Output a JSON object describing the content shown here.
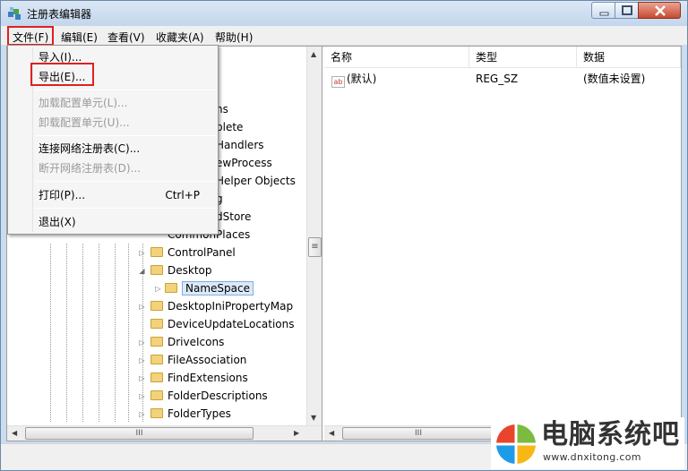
{
  "window": {
    "title": "注册表编辑器"
  },
  "menubar": {
    "items": [
      "文件(F)",
      "编辑(E)",
      "查看(V)",
      "收藏夹(A)",
      "帮助(H)"
    ]
  },
  "file_menu": {
    "items": [
      {
        "label": "导入(I)...",
        "accel": "",
        "enabled": true
      },
      {
        "label": "导出(E)...",
        "accel": "",
        "enabled": true
      },
      {
        "label": "加载配置单元(L)...",
        "accel": "",
        "enabled": false
      },
      {
        "label": "卸载配置单元(U)...",
        "accel": "",
        "enabled": false
      },
      {
        "label": "连接网络注册表(C)...",
        "accel": "",
        "enabled": true
      },
      {
        "label": "断开网络注册表(D)...",
        "accel": "",
        "enabled": false
      },
      {
        "label": "打印(P)...",
        "accel": "Ctrl+P",
        "enabled": true
      },
      {
        "label": "退出(X)",
        "accel": "",
        "enabled": true
      }
    ]
  },
  "tree": {
    "partial_rows": [
      "ns",
      "plete",
      "Handlers",
      "ewProcess",
      "Helper Objects",
      "g",
      "dStore",
      "CommonPlaces"
    ],
    "rows": [
      "ControlPanel",
      "Desktop",
      "NameSpace",
      "DesktopIniPropertyMap",
      "DeviceUpdateLocations",
      "DriveIcons",
      "FileAssociation",
      "FindExtensions",
      "FolderDescriptions",
      "FolderTypes"
    ]
  },
  "list": {
    "columns": [
      "名称",
      "类型",
      "数据"
    ],
    "rows": [
      {
        "icon": "string-value-icon",
        "icon_text": "ab",
        "name": "(默认)",
        "type": "REG_SZ",
        "data": "(数值未设置)"
      }
    ]
  },
  "scrollbars": {
    "tree_h_grip": "III",
    "list_h_grip": "III",
    "tree_v_grip": "≡"
  },
  "watermark": {
    "text": "电脑系统吧",
    "url": "www.dnxitong.com"
  },
  "colors": {
    "highlight_red": "#e02020",
    "selection": "#dbe9f9",
    "folder": "#f3d27a"
  }
}
